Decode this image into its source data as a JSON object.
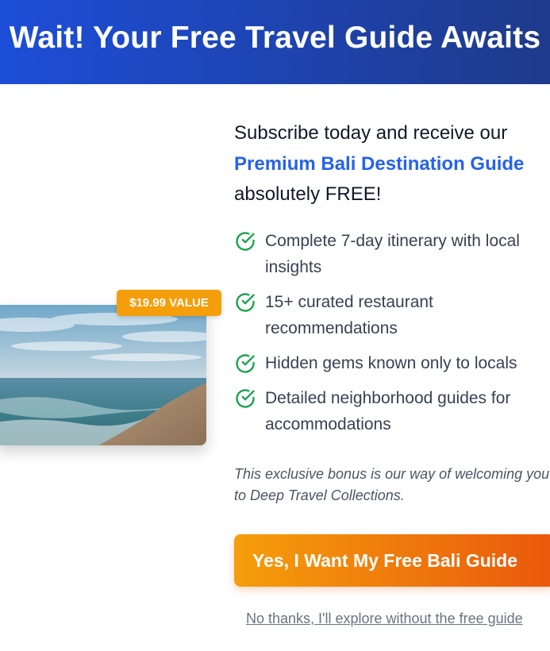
{
  "header": {
    "title": "Wait! Your Free Travel Guide Awaits"
  },
  "image": {
    "alt": "Bali beach at sunset"
  },
  "badge": {
    "label": "$19.99 VALUE"
  },
  "intro": {
    "line1": "Subscribe today and receive our",
    "highlight": "Premium Bali Destination Guide",
    "line3": "absolutely FREE!"
  },
  "features": [
    {
      "icon": "check-circle-icon",
      "text": "Complete 7-day itinerary with local insights"
    },
    {
      "icon": "check-circle-icon",
      "text": "15+ curated restaurant recommendations"
    },
    {
      "icon": "check-circle-icon",
      "text": "Hidden gems known only to locals"
    },
    {
      "icon": "check-circle-icon",
      "text": "Detailed neighborhood guides for accommodations"
    }
  ],
  "note": "This exclusive bonus is our way of welcoming you to Deep Travel Collections.",
  "cta": {
    "label": "Yes, I Want My Free Bali Guide"
  },
  "decline": {
    "label": "No thanks, I'll explore without the free guide"
  },
  "colors": {
    "header_start": "#1d4ed8",
    "header_end": "#1e3a8a",
    "highlight": "#2563eb",
    "check": "#16a34a",
    "badge": "#f59e0b",
    "cta_start": "#f59e0b",
    "cta_end": "#ea580c"
  }
}
